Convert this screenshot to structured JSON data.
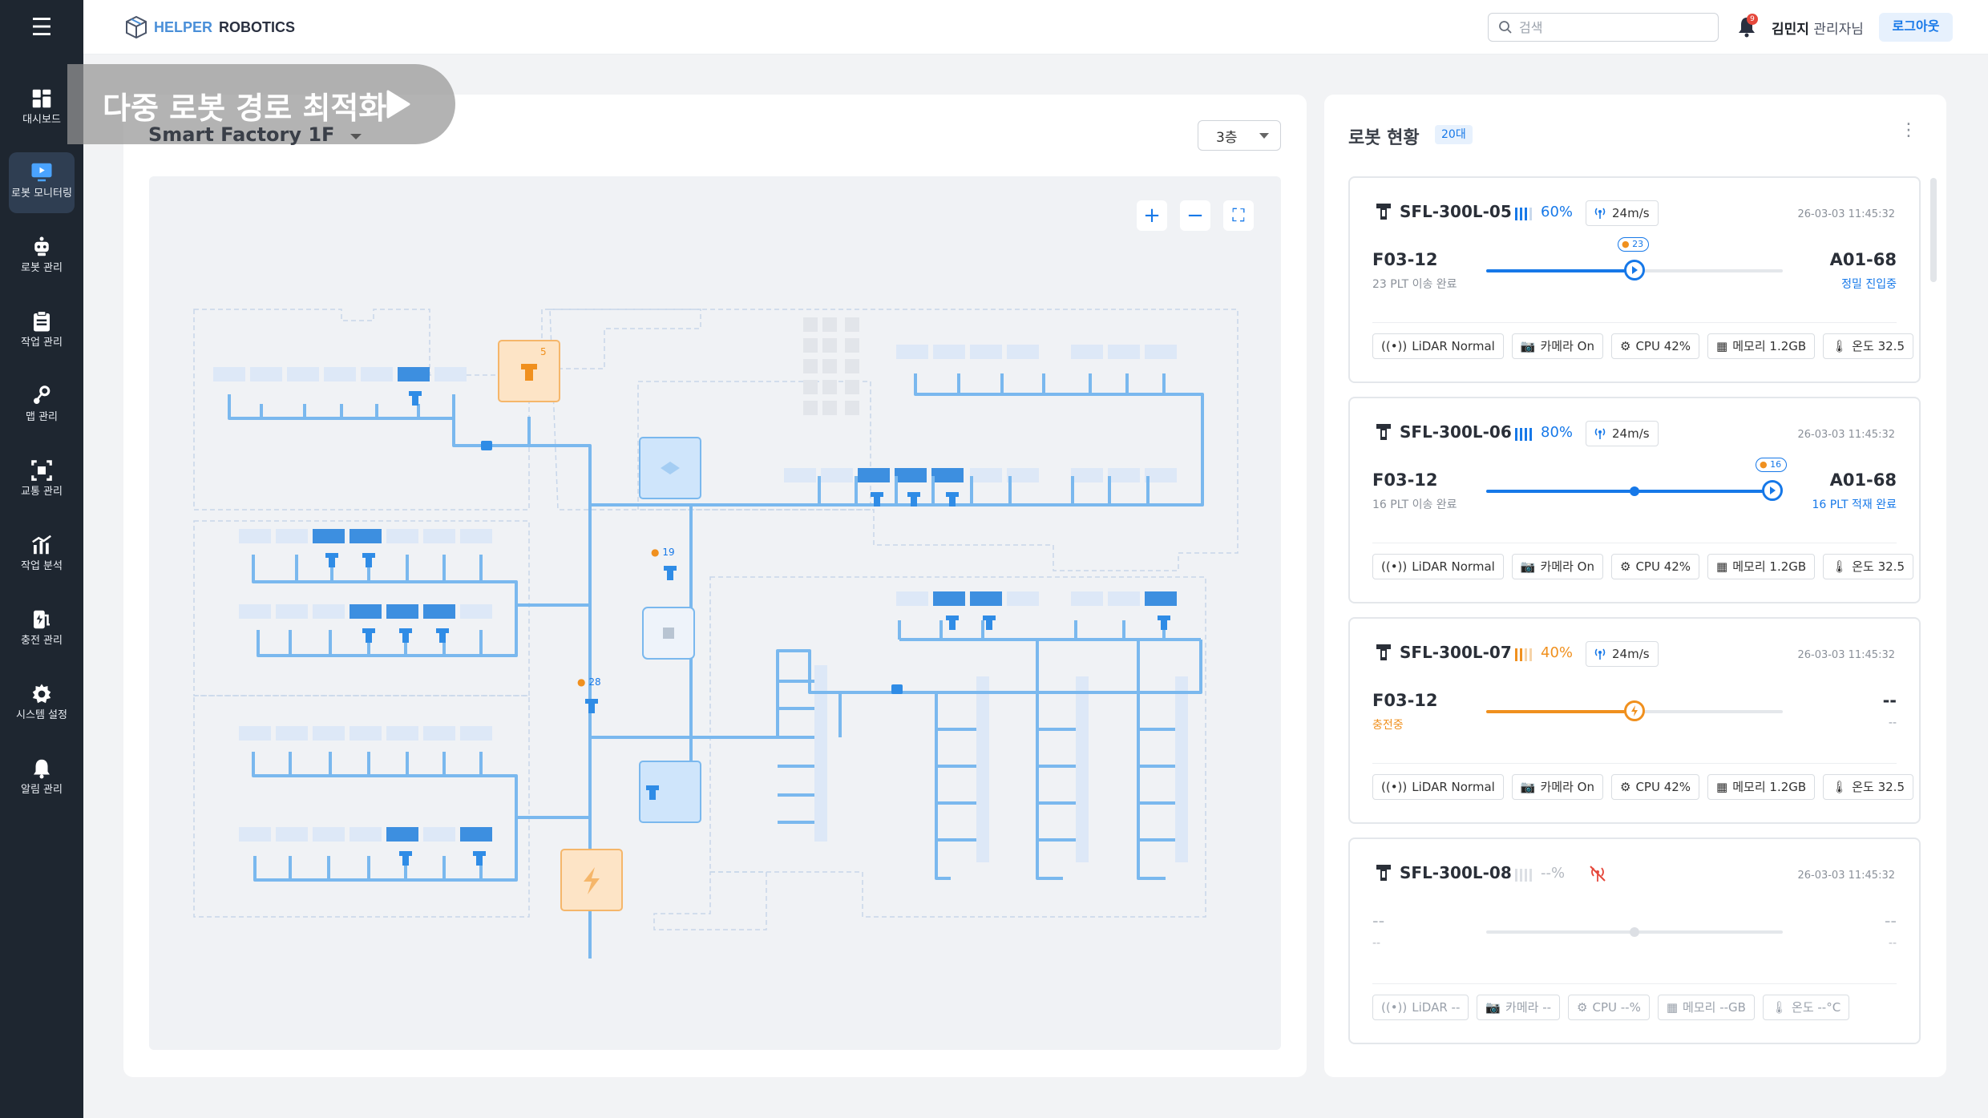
{
  "sidebar": {
    "items": [
      {
        "label": "대시보드",
        "icon": "dashboard-icon"
      },
      {
        "label": "로봇 모니터링",
        "icon": "monitor-icon"
      },
      {
        "label": "로봇 관리",
        "icon": "robot-icon"
      },
      {
        "label": "작업 관리",
        "icon": "clipboard-icon"
      },
      {
        "label": "맵 관리",
        "icon": "map-pin-icon"
      },
      {
        "label": "교통 관리",
        "icon": "traffic-icon"
      },
      {
        "label": "작업 분석",
        "icon": "analytics-icon"
      },
      {
        "label": "충전 관리",
        "icon": "charging-icon"
      },
      {
        "label": "시스템 설정",
        "icon": "gear-icon"
      },
      {
        "label": "알림 관리",
        "icon": "bell-icon"
      }
    ],
    "active_index": 1
  },
  "header": {
    "logo_part1": "HELPER",
    "logo_part2": "ROBOTICS",
    "search_placeholder": "검색",
    "notification_count": "9",
    "user_name": "김민지",
    "user_role": "관리자님",
    "logout_label": "로그아웃"
  },
  "map_panel": {
    "banner": "다중 로봇 경로 최적화",
    "title": "Smart Factory 1F",
    "floor": "3층",
    "tools": {
      "zoom_in": "+",
      "zoom_out": "−",
      "fullscreen": "⛶"
    },
    "badges": {
      "charger_qty": "5",
      "junction_qty": "19",
      "lower_qty": "28"
    }
  },
  "robot_panel": {
    "title": "로봇 현황",
    "count": "20대",
    "robots": [
      {
        "name": "SFL-300L-05",
        "battery": "60%",
        "battery_level": 0.6,
        "speed": "24m/s",
        "timestamp": "26-03-03 11:45:32",
        "from": "F03-12",
        "from_sub": "23 PLT 이송 완료",
        "to": "A01-68",
        "to_sub": "정밀 진입중",
        "progress": 0.5,
        "qty": "23",
        "chips": {
          "lidar": "LiDAR Normal",
          "camera": "카메라 On",
          "cpu": "CPU 42%",
          "memory": "메모리 1.2GB",
          "temp": "온도 32.5"
        }
      },
      {
        "name": "SFL-300L-06",
        "battery": "80%",
        "battery_level": 0.8,
        "speed": "24m/s",
        "timestamp": "26-03-03 11:45:32",
        "from": "F03-12",
        "from_sub": "16 PLT 이송 완료",
        "to": "A01-68",
        "to_sub": "16 PLT 적재 완료",
        "progress": 0.97,
        "qty": "16",
        "chips": {
          "lidar": "LiDAR Normal",
          "camera": "카메라 On",
          "cpu": "CPU 42%",
          "memory": "메모리 1.2GB",
          "temp": "온도 32.5"
        }
      },
      {
        "name": "SFL-300L-07",
        "battery": "40%",
        "battery_level": 0.4,
        "speed": "24m/s",
        "timestamp": "26-03-03 11:45:32",
        "from": "F03-12",
        "from_sub": "충전중",
        "to": "--",
        "to_sub": "--",
        "progress": 0.5,
        "chips": {
          "lidar": "LiDAR Normal",
          "camera": "카메라 On",
          "cpu": "CPU 42%",
          "memory": "메모리 1.2GB",
          "temp": "온도 32.5"
        }
      },
      {
        "name": "SFL-300L-08",
        "battery": "--%",
        "timestamp": "26-03-03 11:45:32",
        "from": "--",
        "from_sub": "--",
        "to": "--",
        "to_sub": "--",
        "chips": {
          "lidar": "LiDAR --",
          "camera": "카메라 --",
          "cpu": "CPU --%",
          "memory": "메모리 --GB",
          "temp": "온도 --°C"
        }
      }
    ]
  },
  "colors": {
    "accent": "#1678e8",
    "charging": "#f0901e",
    "map_line": "#7ab8ee",
    "sidebar": "#1e2630"
  }
}
